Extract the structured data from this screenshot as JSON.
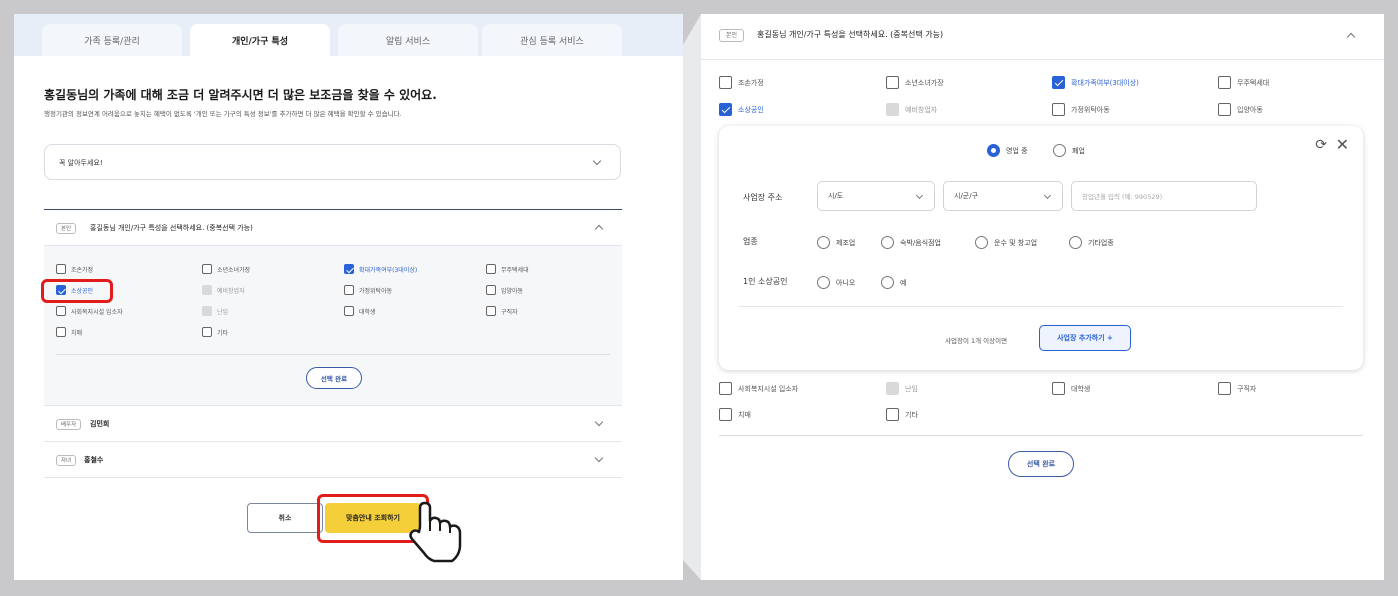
{
  "left": {
    "tabs": [
      {
        "label": "가족 등록/관리"
      },
      {
        "label": "개인/가구 특성"
      },
      {
        "label": "알림 서비스"
      },
      {
        "label": "관심 등록 서비스"
      }
    ],
    "heading": "홍길동님의 가족에 대해 조금 더 알려주시면 더 많은 보조금을 찾을 수 있어요.",
    "subtext": "행정기관의 정보연계 어려움으로 놓치는 혜택이 없도록 '개인 또는 가구의 특성 정보'를 추가하면 더 많은 혜택을 확인할 수 있습니다.",
    "notice_label": "꼭 알아두세요!",
    "self": {
      "tag": "본인",
      "label": "홍길동님 개인/가구 특성을 선택하세요. (중복선택 가능)"
    },
    "options": [
      {
        "label": "조손가정",
        "state": "off"
      },
      {
        "label": "소년소녀가장",
        "state": "off"
      },
      {
        "label": "확대가족여부(3대이상)",
        "state": "on"
      },
      {
        "label": "무주택세대",
        "state": "off"
      },
      {
        "label": "소상공인",
        "state": "on"
      },
      {
        "label": "예비창업자",
        "state": "disabled"
      },
      {
        "label": "가정위탁아동",
        "state": "off"
      },
      {
        "label": "입양아동",
        "state": "off"
      },
      {
        "label": "사회복지시설 입소자",
        "state": "off"
      },
      {
        "label": "난임",
        "state": "disabled"
      },
      {
        "label": "대학생",
        "state": "off"
      },
      {
        "label": "구직자",
        "state": "off"
      },
      {
        "label": "치매",
        "state": "off"
      },
      {
        "label": "기타",
        "state": "off"
      }
    ],
    "done_label": "선택 완료",
    "members": [
      {
        "tag": "배우자",
        "label": "김민희"
      },
      {
        "tag": "자녀",
        "label": "홍철수"
      }
    ],
    "cancel_label": "취소",
    "search_label": "맞춤안내 조회하기"
  },
  "right": {
    "self": {
      "tag": "본인",
      "label": "홍길동님 개인/가구 특성을 선택하세요. (중복선택 가능)"
    },
    "top_options": [
      {
        "label": "조손가정",
        "state": "off"
      },
      {
        "label": "소년소녀가장",
        "state": "off"
      },
      {
        "label": "확대가족여부(3대이상)",
        "state": "on"
      },
      {
        "label": "무주택세대",
        "state": "off"
      },
      {
        "label": "소상공인",
        "state": "on"
      },
      {
        "label": "예비창업자",
        "state": "disabled"
      },
      {
        "label": "가정위탁아동",
        "state": "off"
      },
      {
        "label": "입양아동",
        "state": "off"
      }
    ],
    "business": {
      "status_options": [
        {
          "label": "영업 중",
          "selected": true
        },
        {
          "label": "폐업",
          "selected": false
        }
      ],
      "address_label": "사업장 주소",
      "sido": "시/도",
      "sigungu": "시/군/구",
      "date_placeholder": "창업년월 입력 (예: 990529)",
      "industry_label": "업종",
      "industry_options": [
        {
          "label": "제조업",
          "selected": false
        },
        {
          "label": "숙박/음식점업",
          "selected": false
        },
        {
          "label": "운수 및 창고업",
          "selected": false
        },
        {
          "label": "기타업종",
          "selected": false
        }
      ],
      "solo_label": "1인 소상공인",
      "solo_options": [
        {
          "label": "아니오",
          "selected": false
        },
        {
          "label": "예",
          "selected": false
        }
      ],
      "multi_text": "사업장이 1개 이상이면",
      "add_label": "사업장 추가하기 +"
    },
    "bottom_options": [
      {
        "label": "사회복지시설 입소자",
        "state": "off"
      },
      {
        "label": "난임",
        "state": "disabled"
      },
      {
        "label": "대학생",
        "state": "off"
      },
      {
        "label": "구직자",
        "state": "off"
      },
      {
        "label": "치매",
        "state": "off"
      },
      {
        "label": "기타",
        "state": "off"
      }
    ],
    "done_label": "선택 완료"
  },
  "colors": {
    "accent": "#2862d6",
    "highlight": "#e21b1b",
    "primary_button": "#f5cf3a"
  }
}
